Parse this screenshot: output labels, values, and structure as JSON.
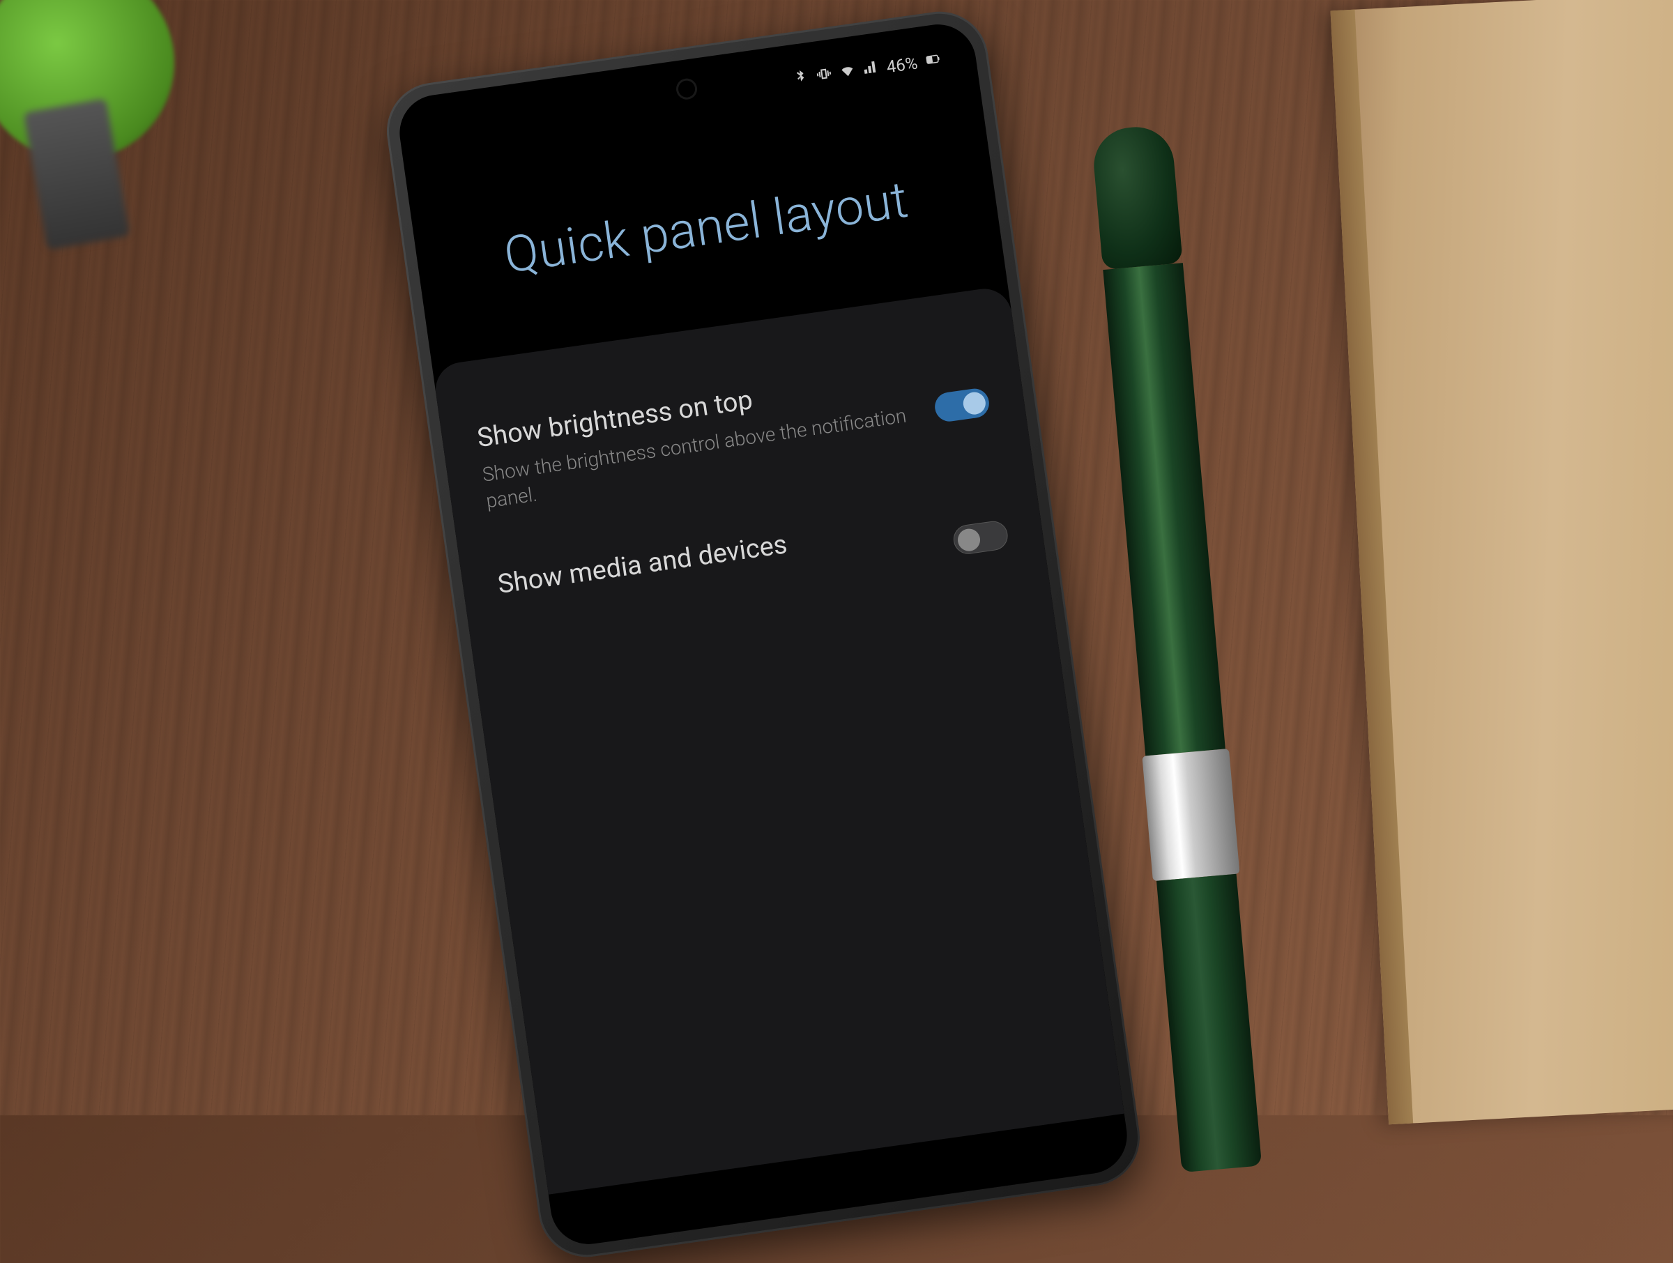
{
  "status_bar": {
    "battery_percent": "46%"
  },
  "page": {
    "title": "Quick panel layout"
  },
  "settings": [
    {
      "title": "Show brightness on top",
      "subtitle": "Show the brightness control above the notification panel.",
      "enabled": true
    },
    {
      "title": "Show media and devices",
      "subtitle": "",
      "enabled": false
    }
  ]
}
